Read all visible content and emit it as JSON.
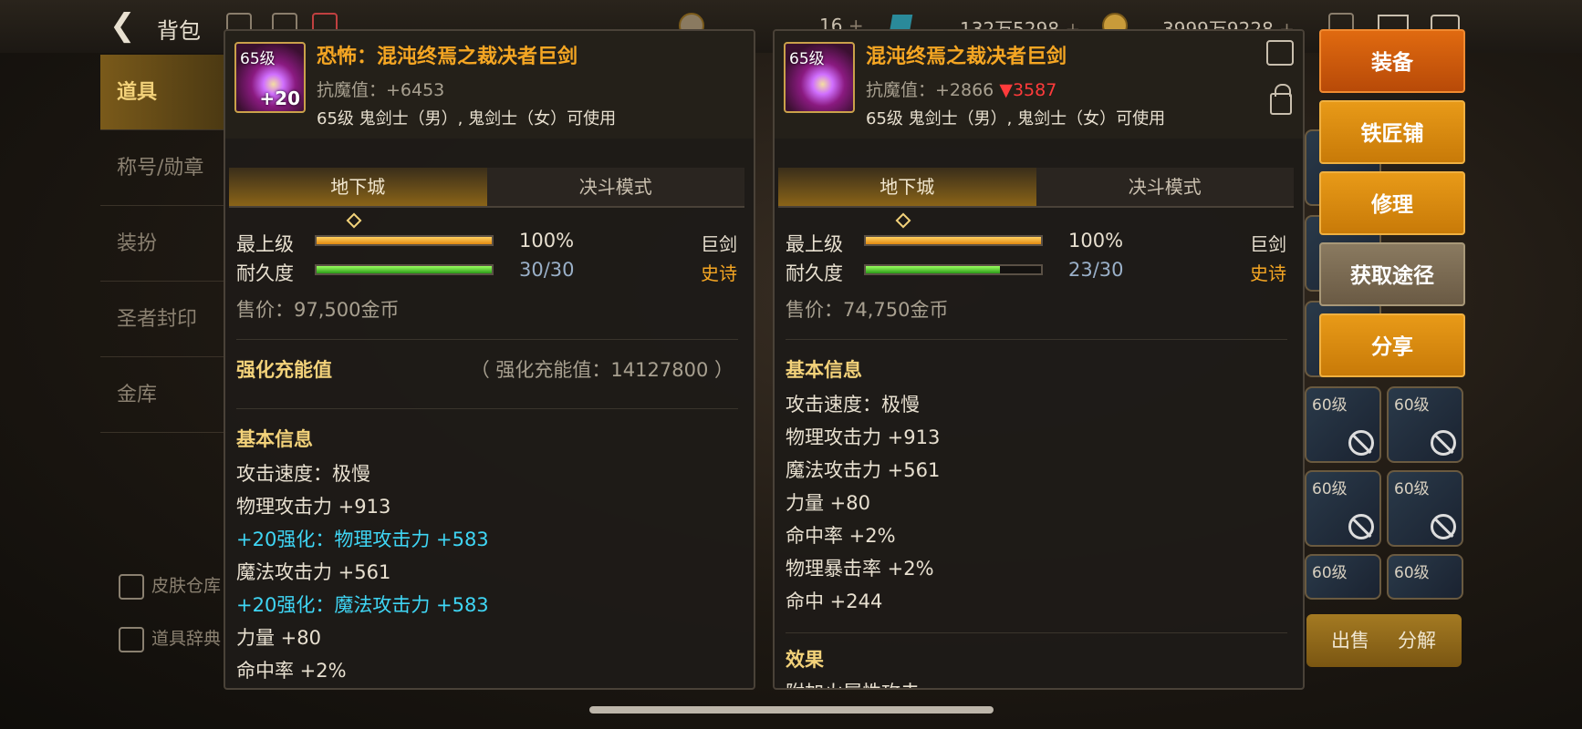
{
  "topbar": {
    "title": "背包",
    "stat_a": "16",
    "stat_b": "132万5298",
    "stat_c": "3999万9228",
    "plus": "+"
  },
  "sidebar": {
    "items": [
      {
        "label": "道具",
        "active": true
      },
      {
        "label": "称号/勋章"
      },
      {
        "label": "装扮"
      },
      {
        "label": "圣者封印"
      },
      {
        "label": "金库"
      }
    ],
    "skin_link": "皮肤仓库",
    "dict_link": "道具辞典"
  },
  "inventory": {
    "level": "60级"
  },
  "bottom_buttons": {
    "sell": "出售",
    "disassemble": "分解"
  },
  "left_panel": {
    "level_tag": "65级",
    "enhance_tag": "+20",
    "name": "恐怖：混沌终焉之裁决者巨剑",
    "anti_magic": "抗魔值：+6453",
    "class_req": "65级 鬼剑士（男）, 鬼剑士（女）可使用",
    "tab_dungeon": "地下城",
    "tab_duel": "决斗模式",
    "grade_label": "最上级",
    "grade_value": "100%",
    "grade_fill": 1.0,
    "durability_label": "耐久度",
    "durability_value": "30/30",
    "durability_fill": 1.0,
    "type_top": "巨剑",
    "type_bottom": "史诗",
    "price": "售价：97,500金币",
    "charge_title": "强化充能值",
    "charge_value": "（ 强化充能值：14127800 ）",
    "basic_title": "基本信息",
    "stats": [
      {
        "text": "攻击速度：极慢",
        "cyan": false
      },
      {
        "text": "物理攻击力 +913",
        "cyan": false
      },
      {
        "text": "+20强化：物理攻击力 +583",
        "cyan": true
      },
      {
        "text": "魔法攻击力 +561",
        "cyan": false
      },
      {
        "text": "+20强化：魔法攻击力 +583",
        "cyan": true
      },
      {
        "text": "力量 +80",
        "cyan": false
      },
      {
        "text": "命中率 +2%",
        "cyan": false
      }
    ]
  },
  "right_panel": {
    "level_tag": "65级",
    "name": "混沌终焉之裁决者巨剑",
    "anti_magic": "抗魔值：+2866",
    "anti_magic_diff": "▼3587",
    "class_req": "65级 鬼剑士（男）, 鬼剑士（女）可使用",
    "tab_dungeon": "地下城",
    "tab_duel": "决斗模式",
    "grade_label": "最上级",
    "grade_value": "100%",
    "grade_fill": 1.0,
    "durability_label": "耐久度",
    "durability_value": "23/30",
    "durability_fill": 0.7667,
    "type_top": "巨剑",
    "type_bottom": "史诗",
    "price": "售价：74,750金币",
    "basic_title": "基本信息",
    "stats": [
      "攻击速度：极慢",
      "物理攻击力 +913",
      "魔法攻击力 +561",
      "力量 +80",
      "命中率 +2%",
      "物理暴击率 +2%",
      "命中 +244"
    ],
    "effect_title": "效果",
    "effect_partial": "附加火属性攻击"
  },
  "actions": [
    {
      "label": "装备",
      "style": "red"
    },
    {
      "label": "铁匠铺",
      "style": "orange"
    },
    {
      "label": "修理",
      "style": "orange"
    },
    {
      "label": "获取途径",
      "style": "gray"
    },
    {
      "label": "分享",
      "style": "orange"
    }
  ]
}
